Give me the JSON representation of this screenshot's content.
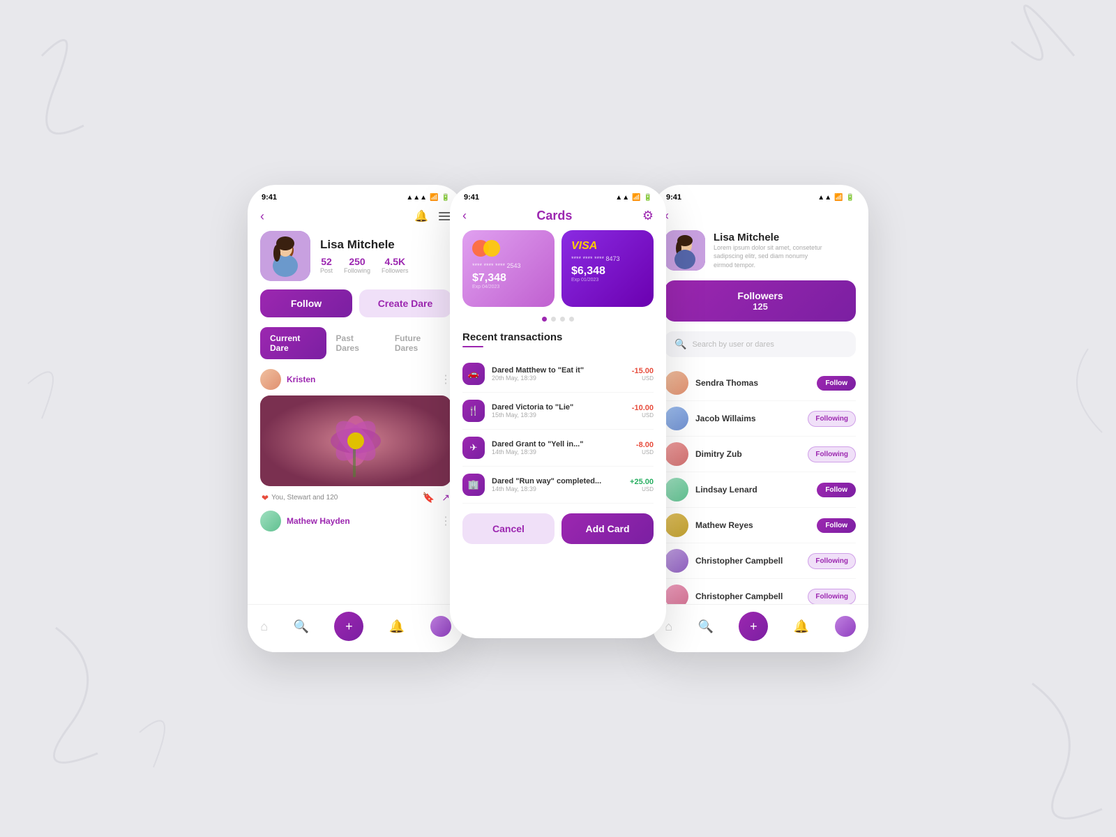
{
  "background": "#e8e8ec",
  "phone_left": {
    "status_time": "9:41",
    "profile": {
      "name": "Lisa Mitchele",
      "stats": {
        "posts": "52",
        "posts_label": "Post",
        "following": "250",
        "following_label": "Following",
        "followers": "4.5K",
        "followers_label": "Followers"
      },
      "buttons": {
        "follow": "Follow",
        "create_dare": "Create Dare"
      },
      "tabs": {
        "current": "Current Dare",
        "past": "Past Dares",
        "future": "Future Dares"
      }
    },
    "post": {
      "username": "Kristen",
      "likes": "You, Stewart and 120"
    },
    "post2_username": "Mathew Hayden"
  },
  "phone_center": {
    "status_time": "9:41",
    "title": "Cards",
    "cards": [
      {
        "type": "mastercard",
        "number": "**** **** **** 2543",
        "balance": "$7,348",
        "expiry": "Exp 04/2023"
      },
      {
        "type": "visa",
        "number": "**** **** **** 8473",
        "balance": "$6,348",
        "expiry": "Exp 01/2023"
      }
    ],
    "transactions_title": "Recent transactions",
    "transactions": [
      {
        "icon": "🚗",
        "title": "Dared Matthew to \"Eat it\"",
        "date": "20th May, 18:39",
        "amount": "-15.00",
        "currency": "USD",
        "type": "neg"
      },
      {
        "icon": "🍴",
        "title": "Dared Victoria to \"Lie\"",
        "date": "15th May, 18:39",
        "amount": "-10.00",
        "currency": "USD",
        "type": "neg"
      },
      {
        "icon": "✈",
        "title": "Dared Grant to \"Yell in...\"",
        "date": "14th May, 18:39",
        "amount": "-8.00",
        "currency": "USD",
        "type": "neg"
      },
      {
        "icon": "🏢",
        "title": "Dared \"Run way\" completed...",
        "date": "14th May, 18:39",
        "amount": "+25.00",
        "currency": "USD",
        "type": "pos"
      }
    ],
    "buttons": {
      "cancel": "Cancel",
      "add_card": "Add Card"
    }
  },
  "phone_right": {
    "status_time": "9:41",
    "profile": {
      "name": "Lisa Mitchele",
      "bio": "Lorem ipsum dolor sit amet, consetetur sadipscing elitr, sed diam nonumy eirmod tempor."
    },
    "followers_banner": {
      "label": "Followers",
      "count": "125"
    },
    "search_placeholder": "Search by user or dares",
    "followers": [
      {
        "name": "Sendra Thomas",
        "status": "follow",
        "av": "av1"
      },
      {
        "name": "Jacob Willaims",
        "status": "following",
        "av": "av2"
      },
      {
        "name": "Dimitry Zub",
        "status": "following",
        "av": "av3"
      },
      {
        "name": "Lindsay Lenard",
        "status": "follow",
        "av": "av4"
      },
      {
        "name": "Mathew Reyes",
        "status": "follow",
        "av": "av5"
      },
      {
        "name": "Christopher Campbell",
        "status": "following",
        "av": "av6"
      },
      {
        "name": "Christopher Campbell",
        "status": "following",
        "av": "av7"
      }
    ],
    "follow_label": "Follow",
    "following_label": "Following"
  }
}
